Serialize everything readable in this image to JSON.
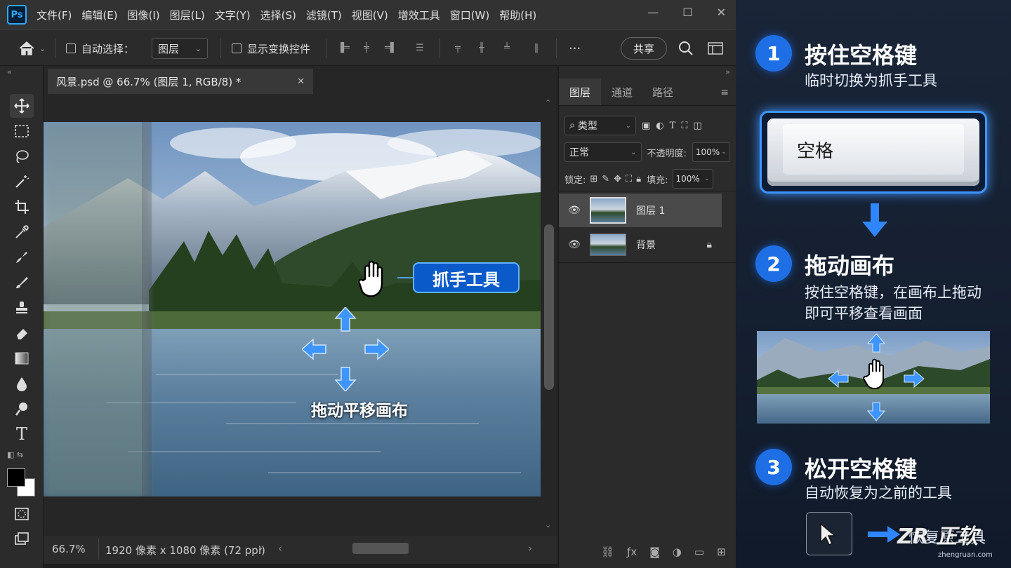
{
  "app": {
    "logo": "Ps"
  },
  "menu": [
    "文件(F)",
    "编辑(E)",
    "图像(I)",
    "图层(L)",
    "文字(Y)",
    "选择(S)",
    "滤镜(T)",
    "视图(V)",
    "增效工具",
    "窗口(W)",
    "帮助(H)"
  ],
  "window_controls": {
    "minimize": "—",
    "maximize": "☐",
    "close": "✕"
  },
  "options_bar": {
    "auto_select_label": "自动选择：",
    "auto_select_value": "图层",
    "show_transform_label": "显示变换控件",
    "more_label": "···",
    "share_label": "共享"
  },
  "document": {
    "tab_title": "风景.psd @ 66.7% (图层 1, RGB/8) *",
    "tab_close": "✕"
  },
  "canvas_overlay": {
    "hand_tool_label": "抓手工具",
    "drag_caption": "拖动平移画布"
  },
  "status": {
    "zoom": "66.7%",
    "dimensions": "1920 像素 x 1080 像素 (72 ppi)"
  },
  "layers_panel": {
    "tabs": [
      "图层",
      "通道",
      "路径"
    ],
    "filter_label": "类型",
    "blend_mode": "正常",
    "opacity_label": "不透明度:",
    "opacity_value": "100%",
    "lock_label": "锁定:",
    "fill_label": "填充:",
    "fill_value": "100%",
    "layers": [
      {
        "name": "图层 1",
        "selected": true
      },
      {
        "name": "背景",
        "locked": true
      }
    ]
  },
  "tutorial": {
    "steps": [
      {
        "number": "1",
        "title": "按住空格键",
        "desc": [
          "临时切换为抓手工具"
        ]
      },
      {
        "number": "2",
        "title": "拖动画布",
        "desc": [
          "按住空格键，在画布上拖动",
          "即可平移查看画面"
        ]
      },
      {
        "number": "3",
        "title": "松开空格键",
        "desc": [
          "自动恢复为之前的工具"
        ]
      }
    ],
    "space_key_label": "空格",
    "restore_text": "恢复原工具",
    "watermark": {
      "brand": "ZR 正软",
      "domain": "zhengruan.com"
    }
  },
  "colors": {
    "accent": "#1e6fe6",
    "ps_blue": "#31a8ff",
    "callout": "#0a5bc9"
  }
}
